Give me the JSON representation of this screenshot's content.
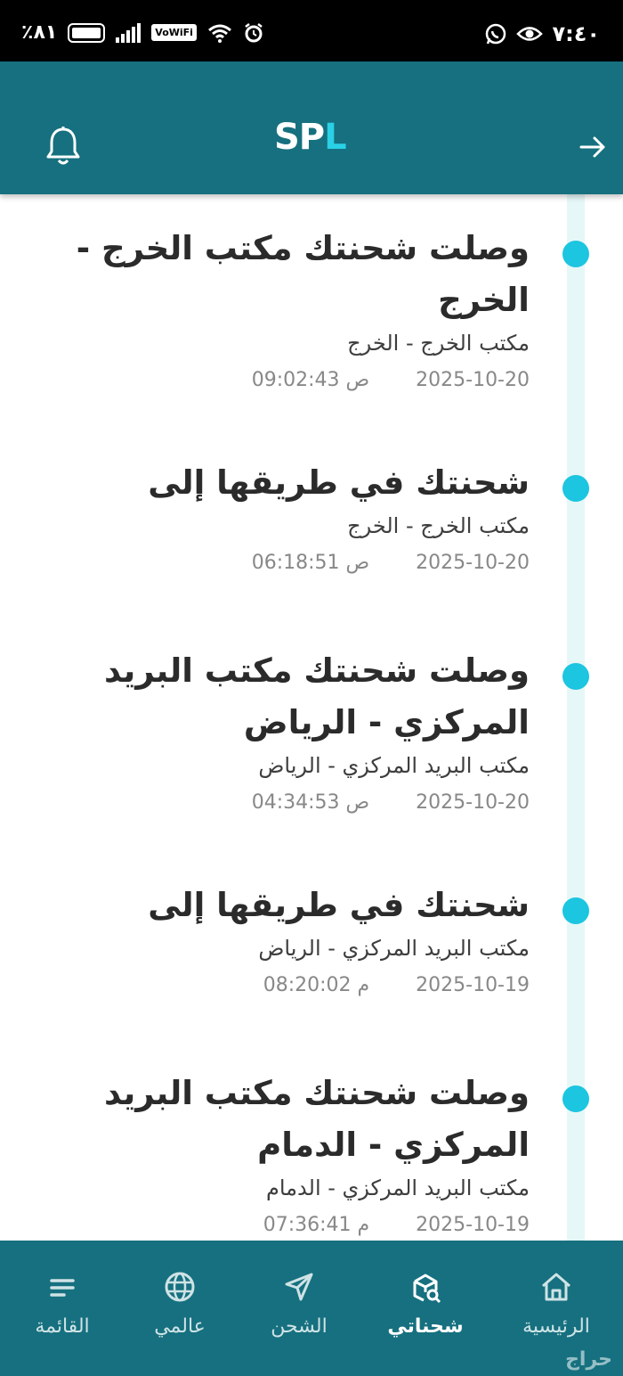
{
  "status_bar": {
    "battery_percent": "٪٨١",
    "network_label": "VoWiFi",
    "time": "٧:٤٠"
  },
  "header": {
    "logo_sp": "SP",
    "logo_l": "L",
    "icons": {
      "left": "bell-icon",
      "right": "arrow-right-icon"
    }
  },
  "colors": {
    "primary": "#16707f",
    "accent_dot": "#1cc5e0",
    "track": "#e6f7f8"
  },
  "events": [
    {
      "title": "وصلت شحنتك مكتب الخرج - الخرج",
      "location": "مكتب الخرج - الخرج",
      "date": "2025-10-20",
      "time": "09:02:43 ص"
    },
    {
      "title": "شحنتك في طريقها إلى",
      "location": "مكتب الخرج - الخرج",
      "date": "2025-10-20",
      "time": "06:18:51 ص"
    },
    {
      "title": "وصلت شحنتك مكتب البريد المركزي - الرياض",
      "location": "مكتب البريد المركزي - الرياض",
      "date": "2025-10-20",
      "time": "04:34:53 ص"
    },
    {
      "title": "شحنتك في طريقها إلى",
      "location": "مكتب البريد المركزي - الرياض",
      "date": "2025-10-19",
      "time": "08:20:02 م"
    },
    {
      "title": "وصلت شحنتك مكتب البريد المركزي - الدمام",
      "location": "مكتب البريد المركزي - الدمام",
      "date": "2025-10-19",
      "time": "07:36:41 م"
    }
  ],
  "nav": {
    "home": "الرئيسية",
    "shipments": "شحناتي",
    "shipping": "الشحن",
    "global": "عالمي",
    "menu": "القائمة",
    "active": "shipments"
  },
  "watermark": "حراج"
}
